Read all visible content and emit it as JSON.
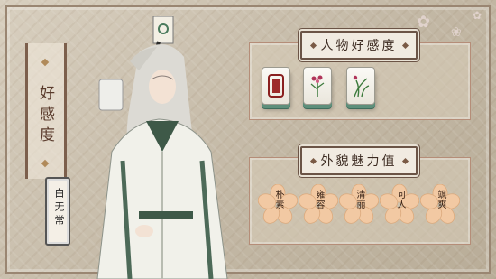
{
  "sidebar": {
    "affinity_label": "好感度"
  },
  "character": {
    "name": "白无常"
  },
  "panels": {
    "affection_title": "人物好感度",
    "charm_title": "外貌魅力值"
  },
  "tiles": [
    {
      "icon": "red-tile-icon"
    },
    {
      "icon": "plum-flower-tile-icon"
    },
    {
      "icon": "orchid-tile-icon"
    }
  ],
  "traits": [
    {
      "label": "朴素"
    },
    {
      "label": "雍容"
    },
    {
      "label": "清丽"
    },
    {
      "label": "可人"
    },
    {
      "label": "飒爽"
    }
  ],
  "colors": {
    "accent": "#6b5446",
    "tile_back": "#5e8f7b",
    "blossom": "#f2c9a3"
  }
}
